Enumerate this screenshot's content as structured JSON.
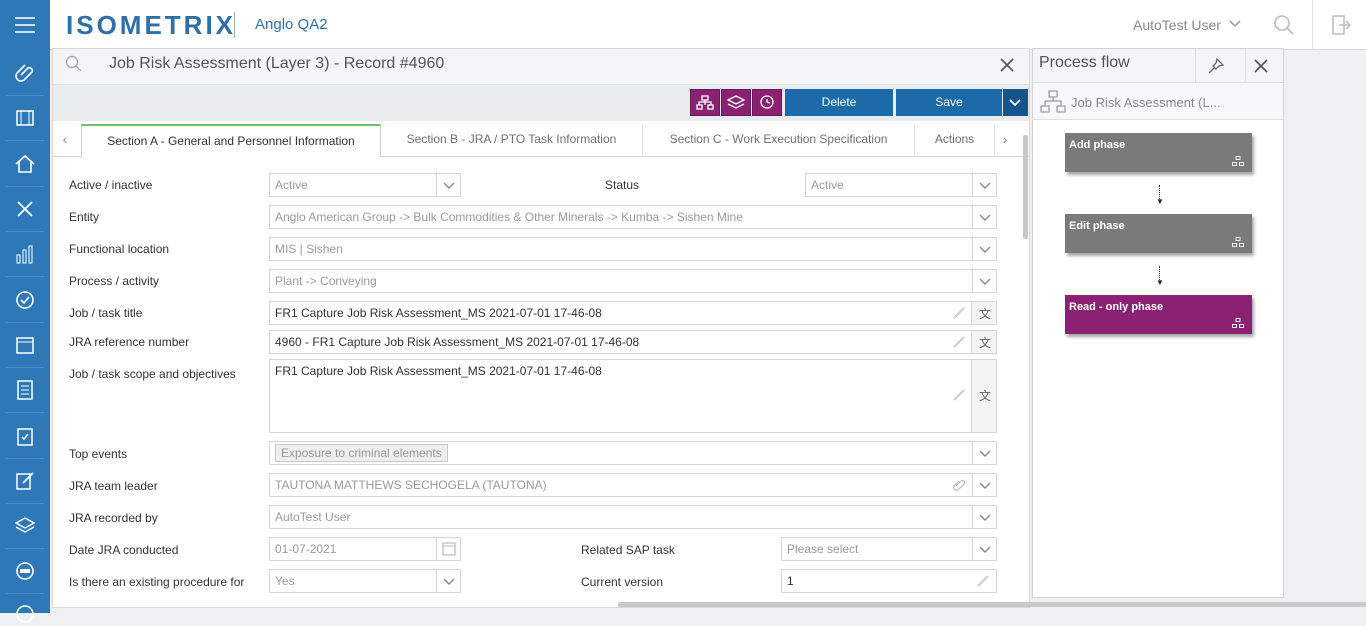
{
  "app": {
    "logo": "ISOMETRIX",
    "instance": "Anglo QA2",
    "user": "AutoTest User"
  },
  "record": {
    "title": "Job Risk Assessment (Layer 3)  - Record #4960"
  },
  "toolbar": {
    "delete_label": "Delete",
    "save_label": "Save"
  },
  "tabs": [
    {
      "label": "Section A - General and Personnel Information"
    },
    {
      "label": "Section B - JRA / PTO Task Information"
    },
    {
      "label": "Section C - Work Execution Specification"
    },
    {
      "label": "Actions"
    }
  ],
  "form": {
    "active_label": "Active / inactive",
    "active_value": "Active",
    "status_label": "Status",
    "status_value": "Active",
    "entity_label": "Entity",
    "entity_value": "Anglo American Group -> Bulk Commodities & Other Minerals -> Kumba -> Sishen Mine",
    "floc_label": "Functional location",
    "floc_value": "MIS | Sishen",
    "process_label": "Process / activity",
    "process_value": "Plant -> Conveying",
    "jobtitle_label": "Job / task title",
    "jobtitle_value": "FR1 Capture Job Risk Assessment_MS 2021-07-01 17-46-08",
    "jraref_label": "JRA reference number",
    "jraref_value": "4960 - FR1 Capture Job Risk Assessment_MS 2021-07-01 17-46-08",
    "scope_label": "Job / task scope and objectives",
    "scope_value": "FR1 Capture Job Risk Assessment_MS 2021-07-01 17-46-08",
    "topevents_label": "Top events",
    "topevents_tag": "Exposure to criminal elements",
    "leader_label": "JRA team leader",
    "leader_value": "TAUTONA MATTHEWS SECHOGELA (TAUTONA)",
    "recorded_label": "JRA recorded by",
    "recorded_value": "AutoTest User",
    "date_label": "Date JRA conducted",
    "date_value": "01-07-2021",
    "sap_label": "Related SAP task",
    "sap_placeholder": "Please select",
    "procedure_label": "Is there an existing procedure for",
    "procedure_value": "Yes",
    "version_label": "Current version",
    "version_value": "1"
  },
  "process_flow": {
    "title": "Process flow",
    "subtitle": "Job Risk Assessment (L...",
    "phases": [
      {
        "label": "Add phase",
        "color": "#7a7a7a"
      },
      {
        "label": "Edit phase",
        "color": "#7a7a7a"
      },
      {
        "label": "Read - only phase",
        "color": "#8b2172"
      }
    ]
  },
  "colors": {
    "brand": "#2e78b8",
    "accent": "#8b2172",
    "button": "#1c6aa8",
    "active_tab": "#69c36b"
  }
}
